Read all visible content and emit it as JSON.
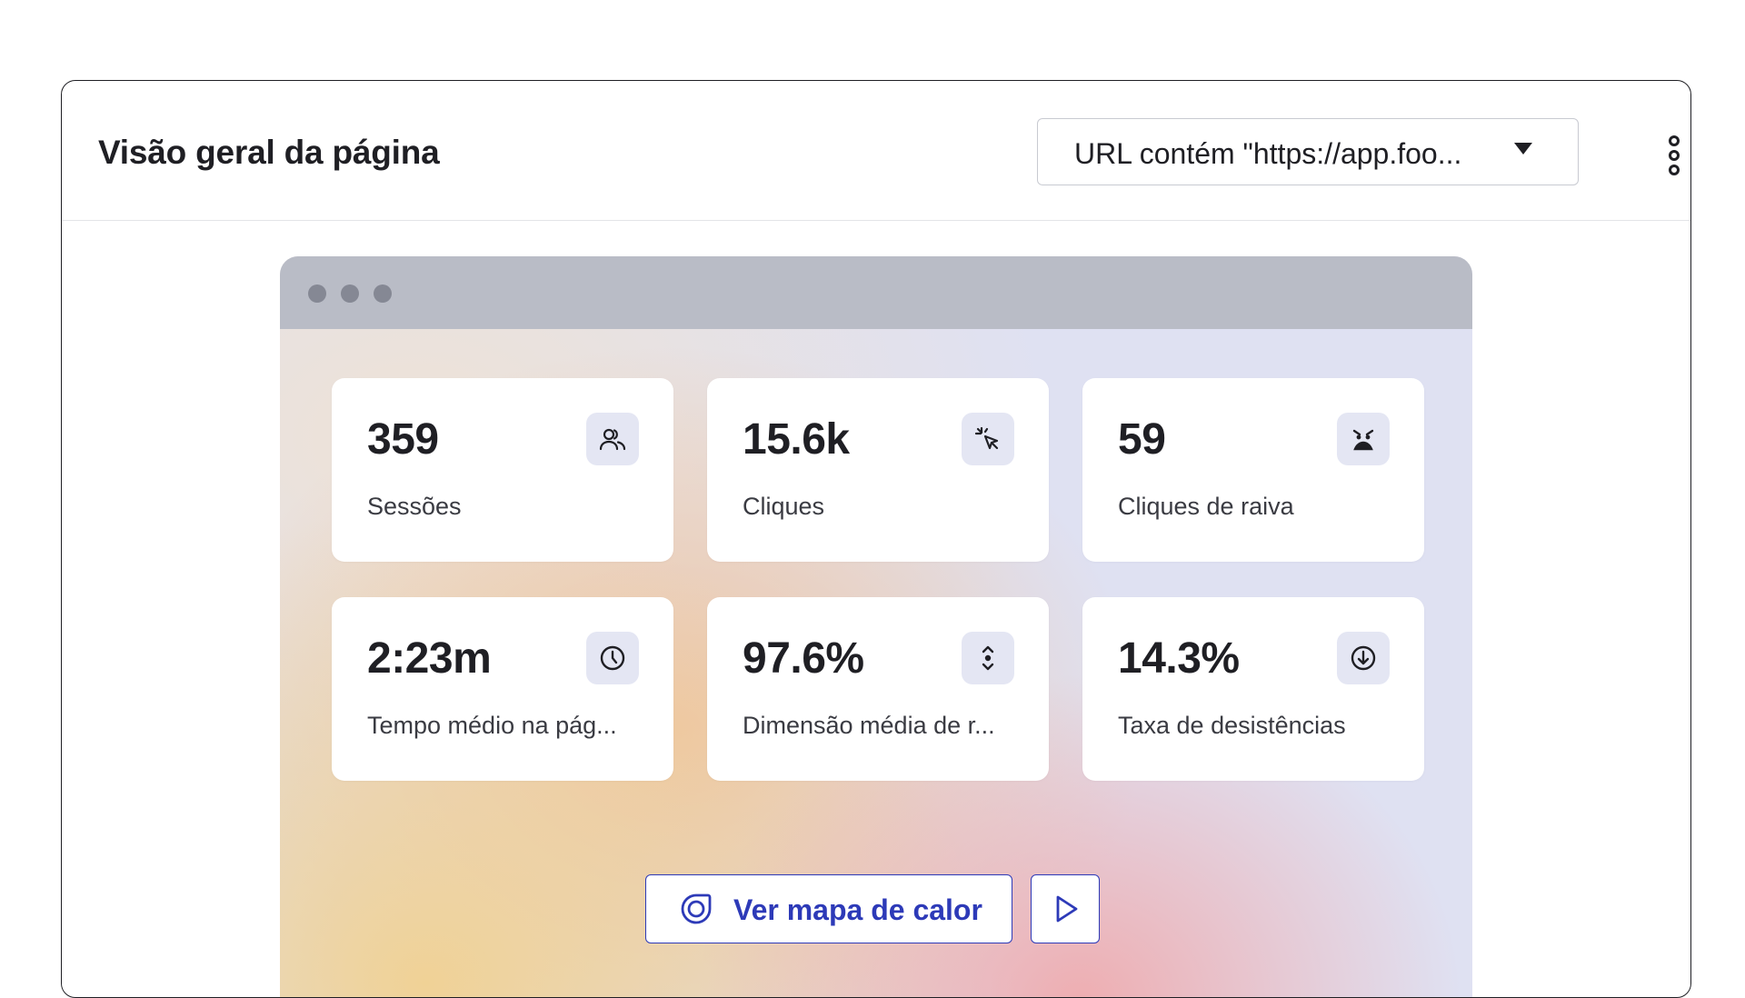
{
  "header": {
    "title": "Visão geral da página",
    "url_filter": "URL contém \"https://app.foo...",
    "caret_icon": "caret-down-icon",
    "menu_icon": "kebab-menu-icon"
  },
  "preview": {
    "window_dots": 3,
    "metrics": [
      {
        "value": "359",
        "label": "Sessões",
        "icon": "users-icon"
      },
      {
        "value": "15.6k",
        "label": "Cliques",
        "icon": "click-cursor-icon"
      },
      {
        "value": "59",
        "label": "Cliques de raiva",
        "icon": "angry-face-icon"
      },
      {
        "value": "2:23m",
        "label": "Tempo médio na pág...",
        "icon": "clock-icon"
      },
      {
        "value": "97.6%",
        "label": "Dimensão média de r...",
        "icon": "scroll-icon"
      },
      {
        "value": "14.3%",
        "label": "Taxa de desistências",
        "icon": "arrow-down-circle-icon"
      }
    ],
    "heatmap_button": {
      "label": "Ver mapa de calor",
      "icon": "target-icon"
    },
    "play_button": {
      "icon": "play-icon"
    }
  },
  "colors": {
    "accent": "#2d3ab8",
    "text": "#1f1f24",
    "icon_bg": "#e4e6f3",
    "browser_bar": "#b9bcc6"
  }
}
